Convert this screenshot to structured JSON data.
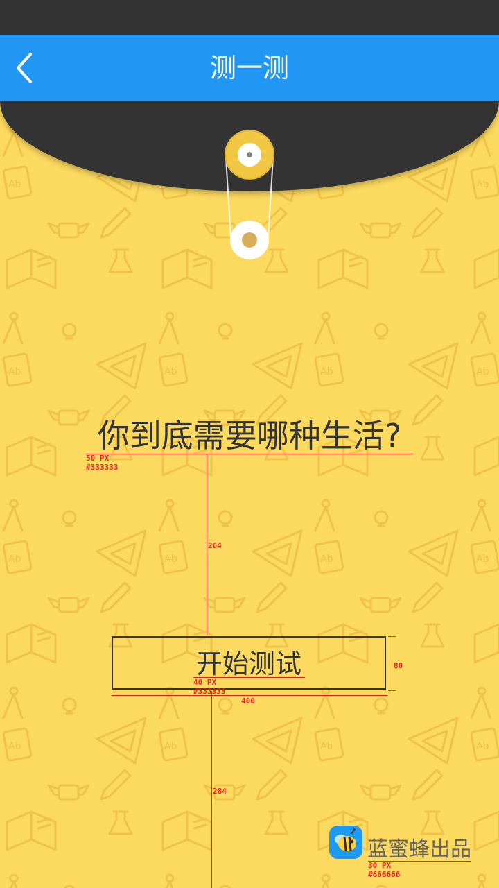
{
  "header": {
    "title": "测一测",
    "back_icon": "chevron-left-icon"
  },
  "colors": {
    "status_bar": "#333333",
    "nav_bar": "#2196f3",
    "background": "#fcd95f",
    "text_primary": "#333333",
    "text_secondary": "#666666",
    "annotation": "#e82020"
  },
  "main": {
    "question": "你到底需要哪种生活?",
    "start_button_label": "开始测试"
  },
  "footer": {
    "brand_text": "蓝蜜蜂出品",
    "brand_icon": "bee-logo-icon"
  },
  "annotations": {
    "question_font": "50 PX",
    "question_color": "#333333",
    "gap_top": "264",
    "button_font": "40 PX",
    "button_color": "#333333",
    "button_height": "80",
    "button_width": "400",
    "gap_bottom": "284",
    "brand_font": "30 PX",
    "brand_color": "#666666"
  }
}
